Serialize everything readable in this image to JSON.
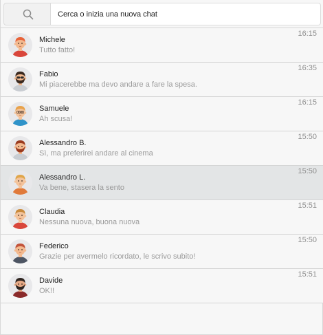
{
  "search": {
    "placeholder": "Cerca o inizia una nuova chat",
    "icon": "search-icon"
  },
  "chats": [
    {
      "name": "Michele",
      "preview": "Tutto fatto!",
      "time": "16:15",
      "active": false,
      "avatar": {
        "hair": "#e8643a",
        "skin": "#f3b98f",
        "shirt": "#d9463b",
        "beard": "",
        "glasses": ""
      }
    },
    {
      "name": "Fabio",
      "preview": "Mi piacerebbe ma devo andare a fare la spesa.",
      "time": "16:35",
      "active": false,
      "avatar": {
        "hair": "#3b2a20",
        "skin": "#f3b98f",
        "shirt": "#c9cdd2",
        "beard": "#3b2a20",
        "glasses": "sunglasses"
      }
    },
    {
      "name": "Samuele",
      "preview": "Ah scusa!",
      "time": "16:15",
      "active": false,
      "avatar": {
        "hair": "#e8a24a",
        "skin": "#f3c39b",
        "shirt": "#2f93c9",
        "beard": "",
        "glasses": "glasses"
      }
    },
    {
      "name": "Alessandro B.",
      "preview": "Sì, ma preferirei andare al cinema",
      "time": "15:50",
      "active": false,
      "avatar": {
        "hair": "#9a3b1f",
        "skin": "#f3b98f",
        "shirt": "#c9cdd2",
        "beard": "#9a3b1f",
        "glasses": ""
      }
    },
    {
      "name": "Alessandro L.",
      "preview": "Va bene, stasera la sento",
      "time": "15:50",
      "active": true,
      "avatar": {
        "hair": "#e0a64a",
        "skin": "#f3c39b",
        "shirt": "#e07a3a",
        "beard": "",
        "glasses": ""
      }
    },
    {
      "name": "Claudia",
      "preview": "Nessuna nuova, buona nuova",
      "time": "15:51",
      "active": false,
      "avatar": {
        "hair": "#c98a3c",
        "skin": "#f3c39b",
        "shirt": "#d9463b",
        "beard": "",
        "glasses": ""
      }
    },
    {
      "name": "Federico",
      "preview": "Grazie per avermelo ricordato, le scrivo subito!",
      "time": "15:50",
      "active": false,
      "avatar": {
        "hair": "#c2533a",
        "skin": "#f3b98f",
        "shirt": "#4d5563",
        "beard": "",
        "glasses": ""
      }
    },
    {
      "name": "Davide",
      "preview": "OK!!",
      "time": "15:51",
      "active": false,
      "avatar": {
        "hair": "#2f2520",
        "skin": "#e7a985",
        "shirt": "#8a2a2a",
        "beard": "#2f2520",
        "glasses": ""
      }
    }
  ]
}
